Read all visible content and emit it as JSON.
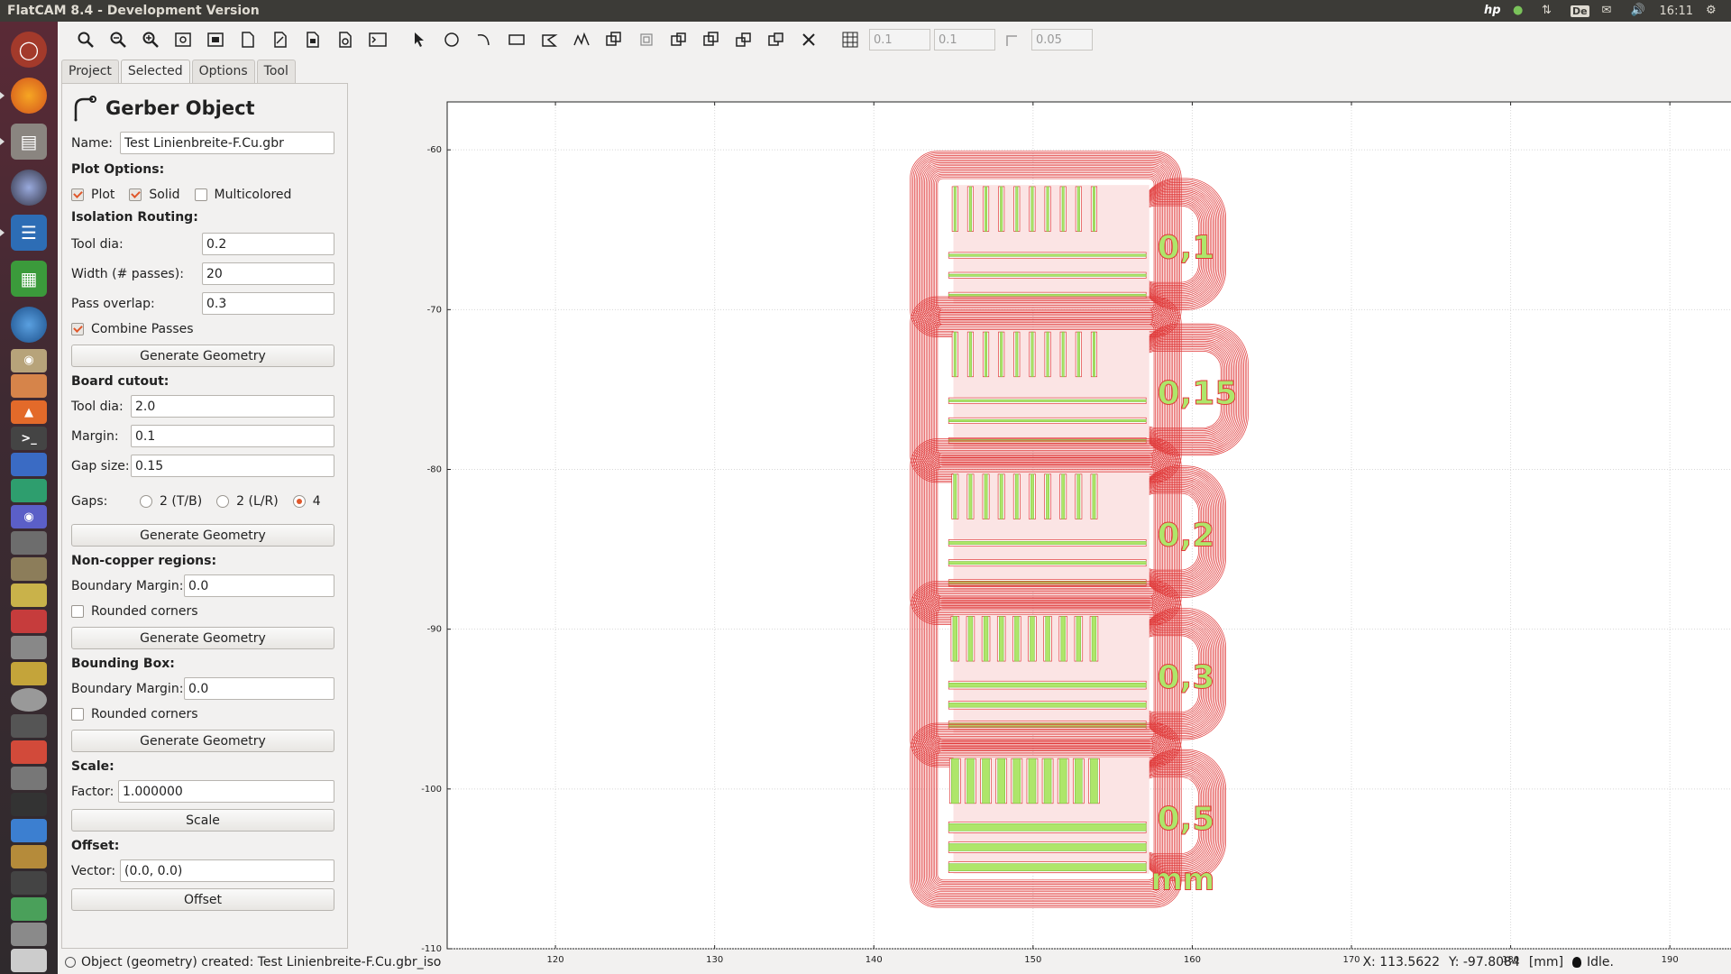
{
  "window": {
    "title": "FlatCAM 8.4 - Development Version"
  },
  "tray": {
    "brand": "hp",
    "lang": "De",
    "time": "16:11"
  },
  "toolbar": {
    "grid_x": "0.1",
    "grid_y": "0.1",
    "snap_max": "0.05"
  },
  "tabs": [
    "Project",
    "Selected",
    "Options",
    "Tool"
  ],
  "panel": {
    "title": "Gerber Object",
    "name_label": "Name:",
    "name_value": "Test Linienbreite-F.Cu.gbr",
    "plot_options": "Plot Options:",
    "plot": "Plot",
    "solid": "Solid",
    "multicolored": "Multicolored",
    "isolation_routing": "Isolation Routing:",
    "iso_tool_dia_label": "Tool dia:",
    "iso_tool_dia": "0.2",
    "width_passes_label": "Width (# passes):",
    "width_passes": "20",
    "pass_overlap_label": "Pass overlap:",
    "pass_overlap": "0.3",
    "combine_passes": "Combine Passes",
    "generate_geometry": "Generate Geometry",
    "board_cutout": "Board cutout:",
    "cut_tool_dia_label": "Tool dia:",
    "cut_tool_dia": "2.0",
    "margin_label": "Margin:",
    "margin": "0.1",
    "gap_size_label": "Gap size:",
    "gap_size": "0.15",
    "gaps_label": "Gaps:",
    "gap_tb": "2 (T/B)",
    "gap_lr": "2 (L/R)",
    "gap_4": "4",
    "noncopper": "Non-copper regions:",
    "nc_boundary_label": "Boundary Margin:",
    "nc_boundary": "0.0",
    "nc_rounded": "Rounded corners",
    "bbox": "Bounding Box:",
    "bb_boundary_label": "Boundary Margin:",
    "bb_boundary": "0.0",
    "bb_rounded": "Rounded corners",
    "scale": "Scale:",
    "factor_label": "Factor:",
    "factor": "1.000000",
    "scale_btn": "Scale",
    "offset": "Offset:",
    "vector_label": "Vector:",
    "vector": "(0.0, 0.0)",
    "offset_btn": "Offset"
  },
  "status": {
    "message": "Object (geometry) created: Test Linienbreite-F.Cu.gbr_iso",
    "x": "X: 113.5622",
    "y": "Y: -97.8084",
    "units": "[mm]",
    "state": "Idle."
  },
  "plot": {
    "x_ticks": [
      120,
      130,
      140,
      150,
      160,
      170,
      180,
      190
    ],
    "y_ticks": [
      -60,
      -70,
      -80,
      -90,
      -100,
      -110
    ],
    "xlim": [
      113.2,
      195.2
    ],
    "ylim": [
      -110,
      -57
    ],
    "trace_color": "#e03a3a",
    "copper_color": "#aee66a",
    "labels": [
      "0,1",
      "0,15",
      "0,2",
      "0,3",
      "0,5",
      "mm"
    ],
    "groups": [
      {
        "top": -61.8,
        "bottom": -70.0,
        "label": "0,1",
        "width": 0.1
      },
      {
        "top": -70.9,
        "bottom": -79.1,
        "label": "0,15",
        "width": 0.15
      },
      {
        "top": -79.8,
        "bottom": -88.0,
        "label": "0,2",
        "width": 0.2
      },
      {
        "top": -88.7,
        "bottom": -96.9,
        "label": "0,3",
        "width": 0.3
      },
      {
        "top": -97.6,
        "bottom": -105.7,
        "label": "0,5",
        "width": 0.5
      }
    ]
  }
}
